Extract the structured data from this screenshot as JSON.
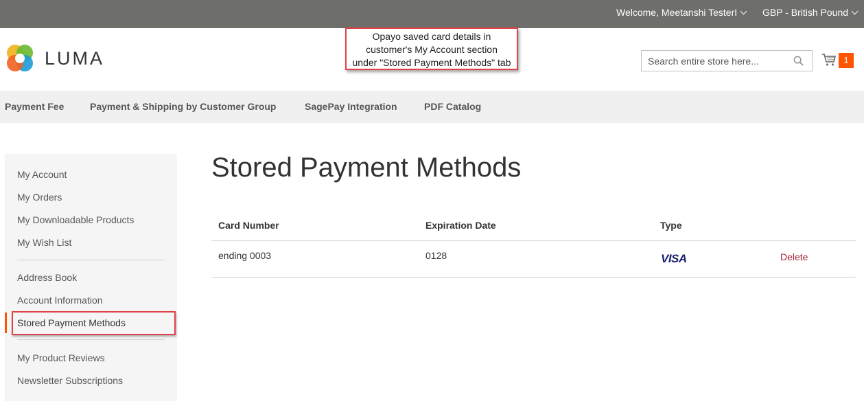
{
  "topbar": {
    "welcome": "Welcome, Meetanshi TesterI",
    "currency": "GBP - British Pound"
  },
  "header": {
    "logo_text": "LUMA",
    "search_placeholder": "Search entire store here...",
    "cart_count": "1"
  },
  "annotation": {
    "line1": "Opayo saved card details in",
    "line2": "customer's My Account section",
    "line3": "under \"Stored Payment Methods\" tab"
  },
  "nav": {
    "items": [
      {
        "label": "Payment Fee"
      },
      {
        "label": "Payment & Shipping by Customer Group"
      },
      {
        "label": "SagePay Integration"
      },
      {
        "label": "PDF Catalog"
      }
    ]
  },
  "sidebar": {
    "items": [
      {
        "label": "My Account"
      },
      {
        "label": "My Orders"
      },
      {
        "label": "My Downloadable Products"
      },
      {
        "label": "My Wish List"
      },
      {
        "label": "Address Book"
      },
      {
        "label": "Account Information"
      },
      {
        "label": "Stored Payment Methods"
      },
      {
        "label": "My Product Reviews"
      },
      {
        "label": "Newsletter Subscriptions"
      }
    ]
  },
  "main": {
    "title": "Stored Payment Methods",
    "table": {
      "headers": [
        "Card Number",
        "Expiration Date",
        "Type"
      ],
      "rows": [
        {
          "card_number": "ending 0003",
          "expiration": "0128",
          "type": "VISA",
          "action": "Delete"
        }
      ]
    }
  },
  "colors": {
    "accent": "#ff5501",
    "annotation_border": "#e0424a",
    "delete_link": "#a5253a"
  }
}
